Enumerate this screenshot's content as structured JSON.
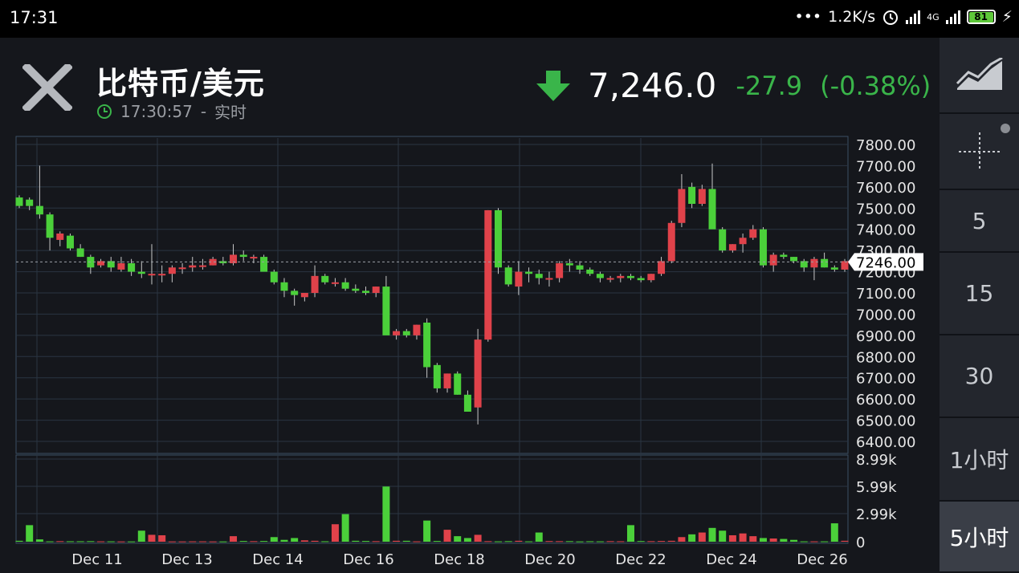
{
  "status": {
    "time": "17:31",
    "speed": "1.2K/s",
    "network": "4G",
    "battery": "81"
  },
  "header": {
    "pair": "比特币/美元",
    "timestamp": "17:30:57",
    "mode": "实时",
    "price": "7,246.0",
    "change": "-27.9",
    "change_pct": "(-0.38%)"
  },
  "colors": {
    "up": "#e0424a",
    "down": "#4bd03a",
    "green_text": "#3ab54a",
    "bg": "#15171c"
  },
  "icons": {
    "close": "close-icon",
    "clock": "clock-icon",
    "arrow": "down-arrow-icon",
    "chart_type": "area-chart-icon",
    "crosshair": "crosshair-icon"
  },
  "sidebar": {
    "items": [
      {
        "label": ""
      },
      {
        "label": ""
      },
      {
        "label": "5"
      },
      {
        "label": "15"
      },
      {
        "label": "30"
      },
      {
        "label": "1小时"
      },
      {
        "label": "5小时"
      }
    ],
    "active": 6
  },
  "chart_data": {
    "type": "candlestick",
    "price_ticks": [
      "7800.00",
      "7700.00",
      "7600.00",
      "7500.00",
      "7400.00",
      "7300.00",
      "7200.00",
      "7100.00",
      "7000.00",
      "6900.00",
      "6800.00",
      "6700.00",
      "6600.00",
      "6500.00",
      "6400.00"
    ],
    "ylim": [
      6400,
      7800
    ],
    "current_price_label": "7246.00",
    "current_price": 7246,
    "volume_ticks": [
      "8.99k",
      "5.99k",
      "2.99k",
      "0"
    ],
    "volume_ylim": [
      0,
      8990
    ],
    "x_labels": [
      "Dec 11",
      "Dec 13",
      "Dec 14",
      "Dec 16",
      "Dec 18",
      "Dec 20",
      "Dec 22",
      "Dec 24",
      "Dec 26"
    ],
    "candles": [
      [
        7550,
        7560,
        7500,
        7510
      ],
      [
        7540,
        7550,
        7490,
        7510
      ],
      [
        7510,
        7700,
        7450,
        7470
      ],
      [
        7470,
        7480,
        7300,
        7360
      ],
      [
        7350,
        7390,
        7320,
        7380
      ],
      [
        7370,
        7380,
        7300,
        7310
      ],
      [
        7310,
        7330,
        7270,
        7270
      ],
      [
        7270,
        7280,
        7190,
        7220
      ],
      [
        7230,
        7260,
        7220,
        7250
      ],
      [
        7250,
        7270,
        7200,
        7220
      ],
      [
        7210,
        7270,
        7200,
        7240
      ],
      [
        7240,
        7260,
        7180,
        7200
      ],
      [
        7200,
        7250,
        7170,
        7190
      ],
      [
        7190,
        7330,
        7140,
        7190
      ],
      [
        7190,
        7230,
        7150,
        7190
      ],
      [
        7190,
        7230,
        7150,
        7220
      ],
      [
        7220,
        7240,
        7190,
        7220
      ],
      [
        7220,
        7270,
        7200,
        7230
      ],
      [
        7230,
        7260,
        7210,
        7230
      ],
      [
        7230,
        7270,
        7230,
        7260
      ],
      [
        7250,
        7270,
        7230,
        7240
      ],
      [
        7240,
        7330,
        7230,
        7280
      ],
      [
        7280,
        7300,
        7250,
        7270
      ],
      [
        7270,
        7280,
        7240,
        7270
      ],
      [
        7270,
        7280,
        7210,
        7200
      ],
      [
        7200,
        7210,
        7140,
        7150
      ],
      [
        7150,
        7170,
        7080,
        7110
      ],
      [
        7110,
        7120,
        7040,
        7090
      ],
      [
        7080,
        7100,
        7060,
        7100
      ],
      [
        7100,
        7230,
        7080,
        7180
      ],
      [
        7180,
        7190,
        7140,
        7150
      ],
      [
        7150,
        7170,
        7130,
        7150
      ],
      [
        7150,
        7170,
        7110,
        7120
      ],
      [
        7120,
        7140,
        7100,
        7110
      ],
      [
        7110,
        7130,
        7090,
        7100
      ],
      [
        7100,
        7130,
        7080,
        7130
      ],
      [
        7130,
        7180,
        7080,
        6900
      ],
      [
        6900,
        6930,
        6880,
        6920
      ],
      [
        6920,
        6930,
        6890,
        6900
      ],
      [
        6900,
        6950,
        6880,
        6950
      ],
      [
        6960,
        6980,
        6700,
        6750
      ],
      [
        6760,
        6770,
        6630,
        6650
      ],
      [
        6650,
        6720,
        6630,
        6720
      ],
      [
        6720,
        6730,
        6620,
        6620
      ],
      [
        6620,
        6640,
        6540,
        6540
      ],
      [
        6560,
        6930,
        6480,
        6880
      ],
      [
        6880,
        7490,
        6870,
        7490
      ],
      [
        7490,
        7500,
        7190,
        7220
      ],
      [
        7220,
        7230,
        7130,
        7140
      ],
      [
        7130,
        7250,
        7090,
        7200
      ],
      [
        7200,
        7220,
        7150,
        7190
      ],
      [
        7190,
        7210,
        7140,
        7170
      ],
      [
        7170,
        7200,
        7130,
        7170
      ],
      [
        7170,
        7250,
        7150,
        7240
      ],
      [
        7240,
        7260,
        7200,
        7230
      ],
      [
        7230,
        7250,
        7190,
        7210
      ],
      [
        7210,
        7220,
        7180,
        7190
      ],
      [
        7190,
        7200,
        7150,
        7170
      ],
      [
        7170,
        7180,
        7150,
        7170
      ],
      [
        7170,
        7190,
        7150,
        7180
      ],
      [
        7180,
        7190,
        7160,
        7170
      ],
      [
        7170,
        7180,
        7150,
        7160
      ],
      [
        7160,
        7190,
        7150,
        7190
      ],
      [
        7190,
        7270,
        7180,
        7250
      ],
      [
        7250,
        7440,
        7240,
        7430
      ],
      [
        7430,
        7660,
        7410,
        7590
      ],
      [
        7600,
        7620,
        7500,
        7520
      ],
      [
        7520,
        7610,
        7510,
        7590
      ],
      [
        7590,
        7710,
        7480,
        7400
      ],
      [
        7400,
        7410,
        7290,
        7300
      ],
      [
        7300,
        7330,
        7290,
        7330
      ],
      [
        7330,
        7380,
        7290,
        7360
      ],
      [
        7360,
        7420,
        7350,
        7400
      ],
      [
        7400,
        7410,
        7220,
        7230
      ],
      [
        7230,
        7290,
        7200,
        7280
      ],
      [
        7280,
        7290,
        7260,
        7270
      ],
      [
        7270,
        7270,
        7240,
        7250
      ],
      [
        7250,
        7260,
        7200,
        7220
      ],
      [
        7220,
        7270,
        7160,
        7260
      ],
      [
        7260,
        7290,
        7220,
        7220
      ],
      [
        7220,
        7230,
        7200,
        7210
      ],
      [
        7210,
        7260,
        7200,
        7250
      ]
    ],
    "volumes": [
      100,
      1800,
      250,
      40,
      60,
      50,
      50,
      60,
      40,
      40,
      30,
      30,
      1200,
      750,
      700,
      30,
      30,
      40,
      40,
      30,
      30,
      600,
      80,
      60,
      80,
      500,
      200,
      400,
      150,
      100,
      50,
      1900,
      3000,
      100,
      80,
      60,
      6000,
      100,
      100,
      40,
      2300,
      80,
      1300,
      600,
      400,
      750,
      60,
      40,
      60,
      100,
      40,
      1000,
      70,
      60,
      60,
      30,
      50,
      40,
      60,
      50,
      1800,
      70,
      60,
      80,
      100,
      500,
      800,
      1000,
      1500,
      1200,
      700,
      900,
      600,
      400,
      350,
      300,
      200,
      40,
      40,
      40,
      2000,
      100
    ]
  }
}
